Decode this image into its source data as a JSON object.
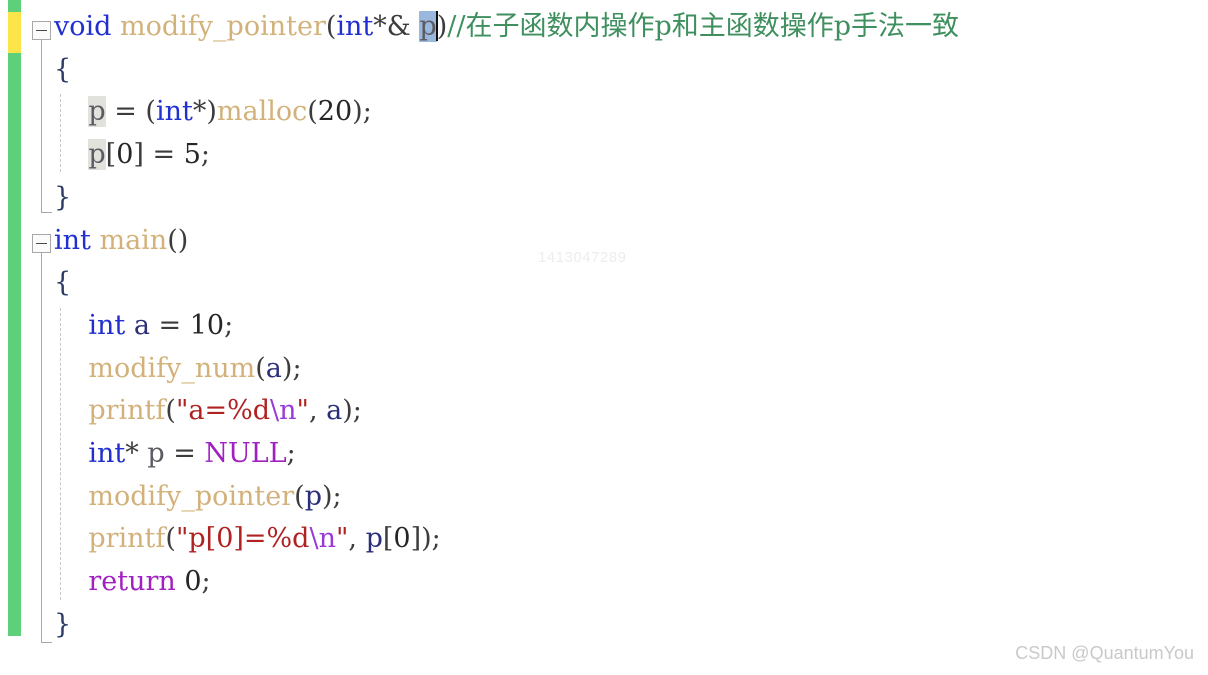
{
  "editor": {
    "language": "C++",
    "font_size_px": 27,
    "line_height_px": 42.7,
    "background": "#ffffff",
    "colors": {
      "keyword": "#1f2fd0",
      "keyword_control": "#a020c0",
      "function": "#d2b27a",
      "string": "#b02222",
      "escape": "#9a3ad6",
      "comment": "#3f8f5f",
      "plain": "#3c3c3c",
      "selection": "#9ab8dd",
      "reference_highlight": "#e2e2dc",
      "change_bar_saved": "#5fd07a",
      "change_bar_unsaved": "#fce44a",
      "squiggle_error": "#2e8b37"
    },
    "gutter": {
      "change_bar_label": "change-bar",
      "unsaved_marker_label": "unsaved-change-marker",
      "fold_marker_glyph": "−"
    },
    "caret": {
      "line": 1,
      "after_token": "p"
    }
  },
  "code": {
    "lines": [
      {
        "n": 1,
        "fold": true,
        "tokens": [
          {
            "t": "void",
            "c": "kw"
          },
          {
            "t": " ",
            "c": "plain"
          },
          {
            "t": "modify_pointer",
            "c": "fn"
          },
          {
            "t": "(",
            "c": "plain"
          },
          {
            "t": "int",
            "c": "kw"
          },
          {
            "t": "*&",
            "c": "plain"
          },
          {
            "t": " ",
            "c": "plain"
          },
          {
            "t": "p",
            "c": "ident",
            "sel": true
          },
          {
            "t": "caret",
            "c": "caret"
          },
          {
            "t": ")",
            "c": "plain"
          },
          {
            "t": "//在子函数内操作p和主函数操作p手法一致",
            "c": "cmt"
          }
        ]
      },
      {
        "n": 2,
        "tokens": [
          {
            "t": "{",
            "c": "brace"
          }
        ]
      },
      {
        "n": 3,
        "tokens": [
          {
            "t": "    ",
            "c": "plain"
          },
          {
            "t": "p",
            "c": "ident",
            "ref": true
          },
          {
            "t": " = (",
            "c": "plain"
          },
          {
            "t": "int",
            "c": "kw"
          },
          {
            "t": "*)",
            "c": "plain"
          },
          {
            "t": "malloc",
            "c": "fn"
          },
          {
            "t": "(",
            "c": "plain"
          },
          {
            "t": "20",
            "c": "num"
          },
          {
            "t": ");",
            "c": "plain"
          }
        ]
      },
      {
        "n": 4,
        "squiggle": true,
        "tokens": [
          {
            "t": "    ",
            "c": "plain"
          },
          {
            "t": "p",
            "c": "ident",
            "ref": true
          },
          {
            "t": "[",
            "c": "plain"
          },
          {
            "t": "0",
            "c": "num"
          },
          {
            "t": "] = ",
            "c": "plain"
          },
          {
            "t": "5",
            "c": "num"
          },
          {
            "t": ";",
            "c": "plain"
          }
        ]
      },
      {
        "n": 5,
        "tokens": [
          {
            "t": "}",
            "c": "brace"
          }
        ]
      },
      {
        "n": 6,
        "fold": true,
        "tokens": [
          {
            "t": "int",
            "c": "kw"
          },
          {
            "t": " ",
            "c": "plain"
          },
          {
            "t": "main",
            "c": "fn"
          },
          {
            "t": "()",
            "c": "plain"
          }
        ]
      },
      {
        "n": 7,
        "tokens": [
          {
            "t": "{",
            "c": "brace"
          }
        ]
      },
      {
        "n": 8,
        "tokens": [
          {
            "t": "    ",
            "c": "plain"
          },
          {
            "t": "int",
            "c": "kw"
          },
          {
            "t": " ",
            "c": "plain"
          },
          {
            "t": "a",
            "c": "var"
          },
          {
            "t": " = ",
            "c": "plain"
          },
          {
            "t": "10",
            "c": "num"
          },
          {
            "t": ";",
            "c": "plain"
          }
        ]
      },
      {
        "n": 9,
        "tokens": [
          {
            "t": "    ",
            "c": "plain"
          },
          {
            "t": "modify_num",
            "c": "fn"
          },
          {
            "t": "(",
            "c": "plain"
          },
          {
            "t": "a",
            "c": "var"
          },
          {
            "t": ");",
            "c": "plain"
          }
        ]
      },
      {
        "n": 10,
        "tokens": [
          {
            "t": "    ",
            "c": "plain"
          },
          {
            "t": "printf",
            "c": "fn"
          },
          {
            "t": "(",
            "c": "plain"
          },
          {
            "t": "\"a=%d",
            "c": "str"
          },
          {
            "t": "\\n",
            "c": "esc"
          },
          {
            "t": "\"",
            "c": "str"
          },
          {
            "t": ", ",
            "c": "plain"
          },
          {
            "t": "a",
            "c": "var"
          },
          {
            "t": ");",
            "c": "plain"
          }
        ]
      },
      {
        "n": 11,
        "tokens": [
          {
            "t": "    ",
            "c": "plain"
          },
          {
            "t": "int",
            "c": "kw"
          },
          {
            "t": "* ",
            "c": "plain"
          },
          {
            "t": "p",
            "c": "ident"
          },
          {
            "t": " = ",
            "c": "plain"
          },
          {
            "t": "NULL",
            "c": "kw2"
          },
          {
            "t": ";",
            "c": "plain"
          }
        ]
      },
      {
        "n": 12,
        "tokens": [
          {
            "t": "    ",
            "c": "plain"
          },
          {
            "t": "modify_pointer",
            "c": "fn"
          },
          {
            "t": "(",
            "c": "plain"
          },
          {
            "t": "p",
            "c": "var"
          },
          {
            "t": ");",
            "c": "plain"
          }
        ]
      },
      {
        "n": 13,
        "tokens": [
          {
            "t": "    ",
            "c": "plain"
          },
          {
            "t": "printf",
            "c": "fn"
          },
          {
            "t": "(",
            "c": "plain"
          },
          {
            "t": "\"p[0]=%d",
            "c": "str"
          },
          {
            "t": "\\n",
            "c": "esc"
          },
          {
            "t": "\"",
            "c": "str"
          },
          {
            "t": ", ",
            "c": "plain"
          },
          {
            "t": "p",
            "c": "var"
          },
          {
            "t": "[",
            "c": "plain"
          },
          {
            "t": "0",
            "c": "num"
          },
          {
            "t": "]);",
            "c": "plain"
          }
        ]
      },
      {
        "n": 14,
        "tokens": [
          {
            "t": "    ",
            "c": "plain"
          },
          {
            "t": "return",
            "c": "kw2"
          },
          {
            "t": " ",
            "c": "plain"
          },
          {
            "t": "0",
            "c": "num"
          },
          {
            "t": ";",
            "c": "plain"
          }
        ]
      },
      {
        "n": 15,
        "tokens": [
          {
            "t": "}",
            "c": "brace"
          }
        ]
      }
    ]
  },
  "watermarks": {
    "user_id": "1413047289",
    "attribution": "CSDN @QuantumYou"
  }
}
